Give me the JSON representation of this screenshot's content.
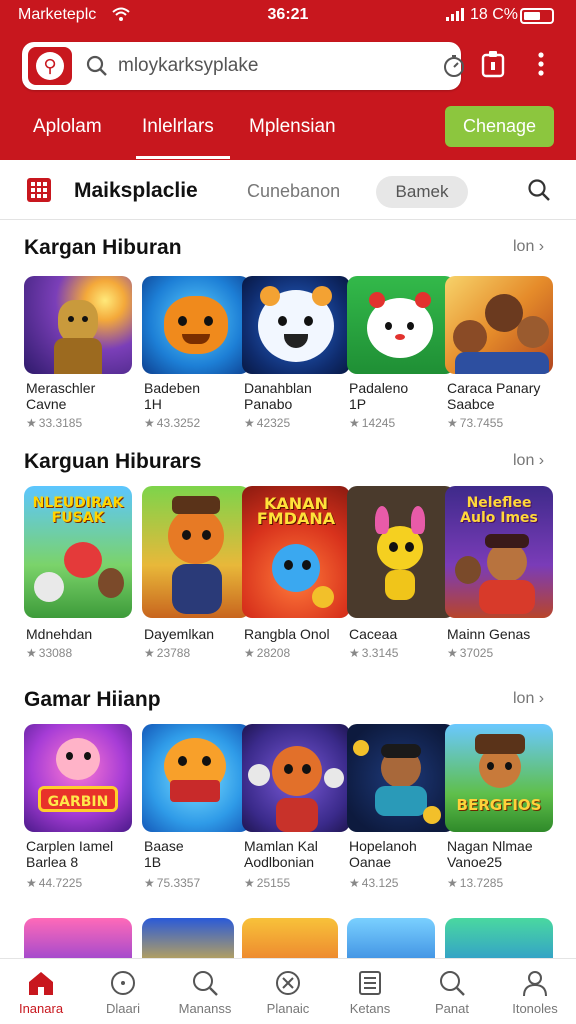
{
  "status_bar": {
    "carrier": "Marketeplc",
    "time": "36:21",
    "battery": "18 C%"
  },
  "search": {
    "placeholder": "mloykarksyplake"
  },
  "tabs": [
    {
      "label": "Aplolam"
    },
    {
      "label": "Inlelrlars"
    },
    {
      "label": "Mplensian"
    }
  ],
  "cta_label": "Chenage",
  "subheader": {
    "title": "Maiksplaclie",
    "link": "Cunebanon",
    "pill": "Bamek"
  },
  "sections": [
    {
      "title": "Kargan Hiburan",
      "more": "lon",
      "apps": [
        {
          "name": [
            "Meraschler",
            "Cavne"
          ],
          "rating": "33.3185"
        },
        {
          "name": [
            "Badeben",
            "1H"
          ],
          "rating": "43.3252"
        },
        {
          "name": [
            "Danahblan",
            "Panabo"
          ],
          "rating": "42325"
        },
        {
          "name": [
            "Padaleno",
            "1P"
          ],
          "rating": "14245"
        },
        {
          "name": [
            "Caraca Panary",
            "Saabce"
          ],
          "rating": "73.7455"
        }
      ]
    },
    {
      "title": "Karguan Hiburars",
      "more": "lon",
      "apps": [
        {
          "name": [
            "Mdnehdan"
          ],
          "rating": "33088",
          "banner": "NLEUDIRAK FUSAK"
        },
        {
          "name": [
            "Dayemlkan"
          ],
          "rating": "23788"
        },
        {
          "name": [
            "Rangbla Onol"
          ],
          "rating": "28208",
          "banner": "KANAN FMDANA"
        },
        {
          "name": [
            "Caceaa"
          ],
          "rating": "3.3145"
        },
        {
          "name": [
            "Mainn Genas"
          ],
          "rating": "37025",
          "banner": "Neleflee Aulo Imes"
        }
      ]
    },
    {
      "title": "Gamar Hiianp",
      "more": "lon",
      "apps": [
        {
          "name": [
            "Carplen Iamel",
            "Barlea 8"
          ],
          "rating": "44.7225",
          "banner": "GARBIN"
        },
        {
          "name": [
            "Baase",
            "1B"
          ],
          "rating": "75.3357"
        },
        {
          "name": [
            "Mamlan Kal",
            "Aodlbonian"
          ],
          "rating": "25155"
        },
        {
          "name": [
            "Hopelanoh",
            "Oanae"
          ],
          "rating": "43.125"
        },
        {
          "name": [
            "Nagan Nlmae",
            "Vanoe25"
          ],
          "rating": "13.7285",
          "banner": "BERGFIOS"
        }
      ]
    }
  ],
  "nav": [
    {
      "label": "Inanara",
      "icon": "home-icon"
    },
    {
      "label": "Dlaari",
      "icon": "compass-icon"
    },
    {
      "label": "Mananss",
      "icon": "search-icon"
    },
    {
      "label": "Planaic",
      "icon": "close-circle-icon"
    },
    {
      "label": "Ketans",
      "icon": "list-icon"
    },
    {
      "label": "Panat",
      "icon": "search-icon"
    },
    {
      "label": "Itonoles",
      "icon": "user-icon"
    }
  ],
  "colors": {
    "brand": "#c8171e",
    "cta": "#8cc63e"
  }
}
